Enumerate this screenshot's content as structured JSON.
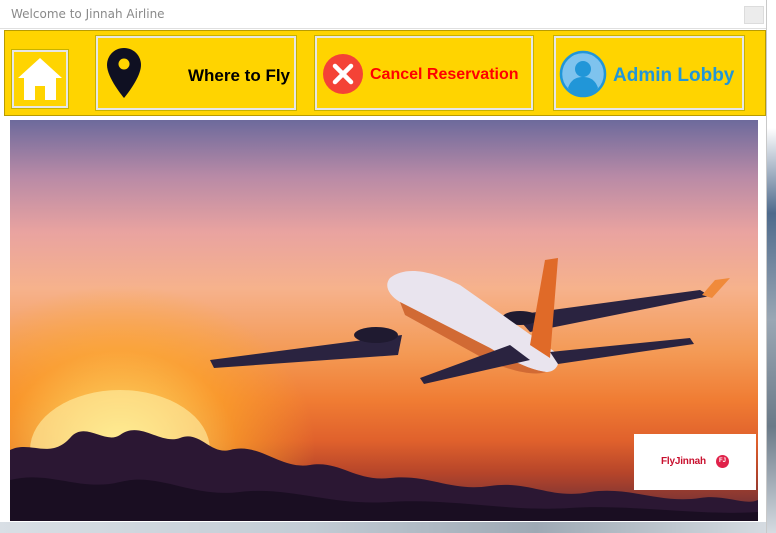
{
  "window": {
    "title": "Welcome to Jinnah Airline"
  },
  "toolbar": {
    "home_icon": "home-icon",
    "where_to_fly_label": "Where to Fly",
    "where_to_fly_icon": "location-pin-icon",
    "cancel_reservation_label": "Cancel Reservation",
    "cancel_reservation_icon": "close-circle-icon",
    "admin_lobby_label": "Admin Lobby",
    "admin_lobby_icon": "user-icon"
  },
  "hero": {
    "image": "airplane-sunset-photo",
    "brand_text": "FlyJinnah",
    "brand_badge": "FJ"
  },
  "colors": {
    "toolbar": "#ffd400",
    "cancel_text": "#ff0000",
    "admin_text": "#2196d8",
    "brand": "#c8102e"
  }
}
